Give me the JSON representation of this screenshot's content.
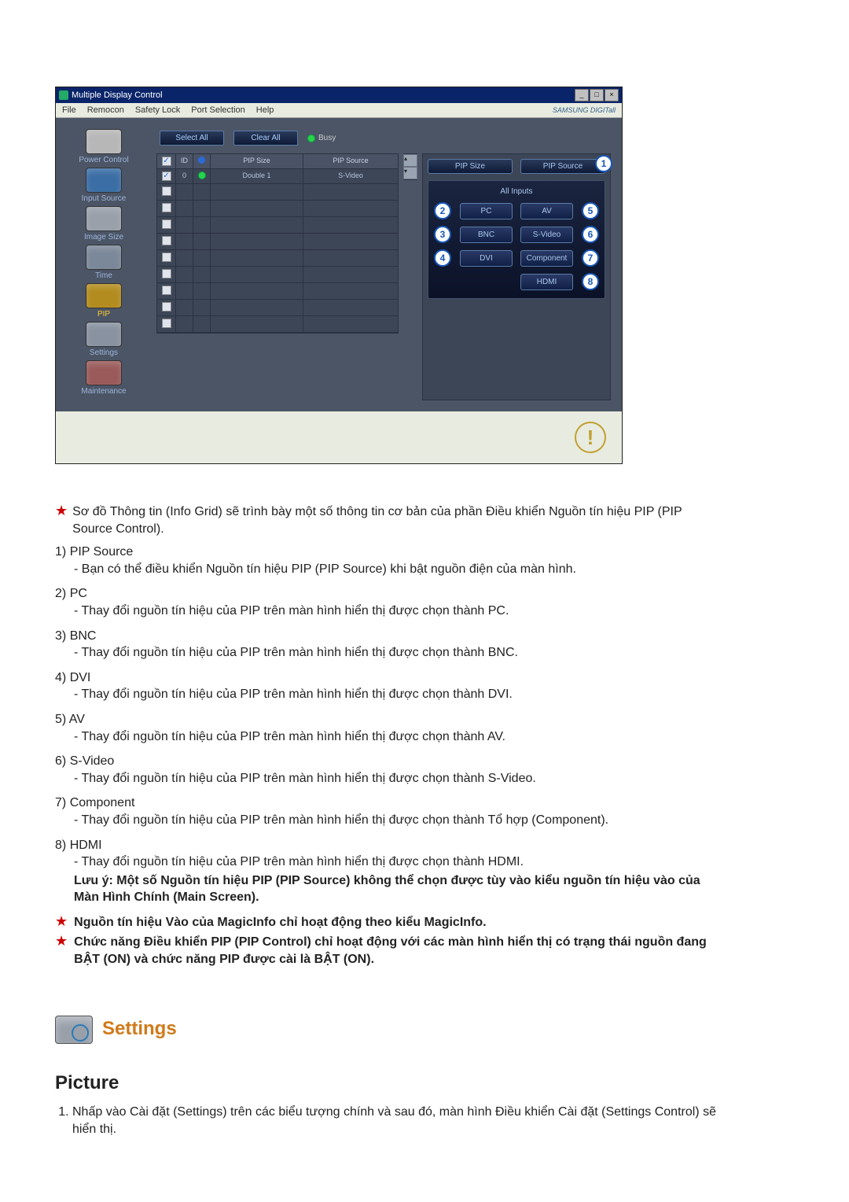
{
  "window": {
    "title": "Multiple Display Control",
    "menus": [
      "File",
      "Remocon",
      "Safety Lock",
      "Port Selection",
      "Help"
    ],
    "brand": "SAMSUNG DIGITall"
  },
  "sidebar": {
    "items": [
      {
        "label": "Power Control"
      },
      {
        "label": "Input Source"
      },
      {
        "label": "Image Size"
      },
      {
        "label": "Time"
      },
      {
        "label": "PIP",
        "active": true
      },
      {
        "label": "Settings"
      },
      {
        "label": "Maintenance"
      }
    ]
  },
  "topButtons": {
    "selectAll": "Select All",
    "clearAll": "Clear All",
    "busy": "Busy"
  },
  "grid": {
    "headers": {
      "id": "ID",
      "pipSize": "PIP Size",
      "pipSource": "PIP Source"
    },
    "row0": {
      "id": "0",
      "pipSize": "Double 1",
      "pipSource": "S-Video"
    },
    "blankRows": 8
  },
  "rightPanel": {
    "pipSize": "PIP Size",
    "pipSource": "PIP Source",
    "allInputs": "All Inputs",
    "buttons": {
      "pc": "PC",
      "bnc": "BNC",
      "dvi": "DVI",
      "av": "AV",
      "svideo": "S-Video",
      "component": "Component",
      "hdmi": "HDMI"
    },
    "badges": {
      "one": "1",
      "two": "2",
      "three": "3",
      "four": "4",
      "five": "5",
      "six": "6",
      "seven": "7",
      "eight": "8"
    }
  },
  "text": {
    "intro": "Sơ đồ Thông tin (Info Grid) sẽ trình bày một số thông tin cơ bản của phần Điều khiển Nguồn tín hiệu PIP (PIP Source Control).",
    "items": [
      {
        "n": "1)",
        "head": "PIP Source",
        "body": "- Bạn có thể điều khiển Nguồn tín hiệu PIP (PIP Source) khi bật nguồn điện của màn hình."
      },
      {
        "n": "2)",
        "head": "PC",
        "body": "- Thay đổi nguồn tín hiệu của PIP trên màn hình hiển thị được chọn thành PC."
      },
      {
        "n": "3)",
        "head": "BNC",
        "body": "- Thay đổi nguồn tín hiệu của PIP trên màn hình hiển thị được chọn thành BNC."
      },
      {
        "n": "4)",
        "head": "DVI",
        "body": "- Thay đổi nguồn tín hiệu của PIP trên màn hình hiển thị được chọn thành DVI."
      },
      {
        "n": "5)",
        "head": "AV",
        "body": "- Thay đổi nguồn tín hiệu của PIP trên màn hình hiển thị được chọn thành AV."
      },
      {
        "n": "6)",
        "head": "S-Video",
        "body": "- Thay đổi nguồn tín hiệu của PIP trên màn hình hiển thị được chọn thành S-Video."
      },
      {
        "n": "7)",
        "head": "Component",
        "body": "- Thay đổi nguồn tín hiệu của PIP trên màn hình hiển thị được chọn thành Tổ hợp (Component)."
      },
      {
        "n": "8)",
        "head": "HDMI",
        "body": "- Thay đổi nguồn tín hiệu của PIP trên màn hình hiển thị được chọn thành HDMI."
      }
    ],
    "note": "Lưu ý: Một số Nguồn tín hiệu PIP (PIP Source) không thể chọn được tùy vào kiểu nguồn tín hiệu vào của Màn Hình Chính (Main Screen).",
    "star1": "Nguồn tín hiệu Vào của MagicInfo chỉ hoạt động theo kiểu MagicInfo.",
    "star2": "Chức năng Điều khiển PIP (PIP Control) chỉ hoạt động với các màn hình hiển thị có trạng thái nguồn đang BẬT (ON) và chức năng PIP được cài là BẬT (ON).",
    "settings": "Settings",
    "picture": "Picture",
    "pictureList1": "Nhấp vào Cài đặt (Settings) trên các biểu tượng chính và sau đó, màn hình Điều khiển Cài đặt (Settings Control) sẽ hiển thị."
  }
}
